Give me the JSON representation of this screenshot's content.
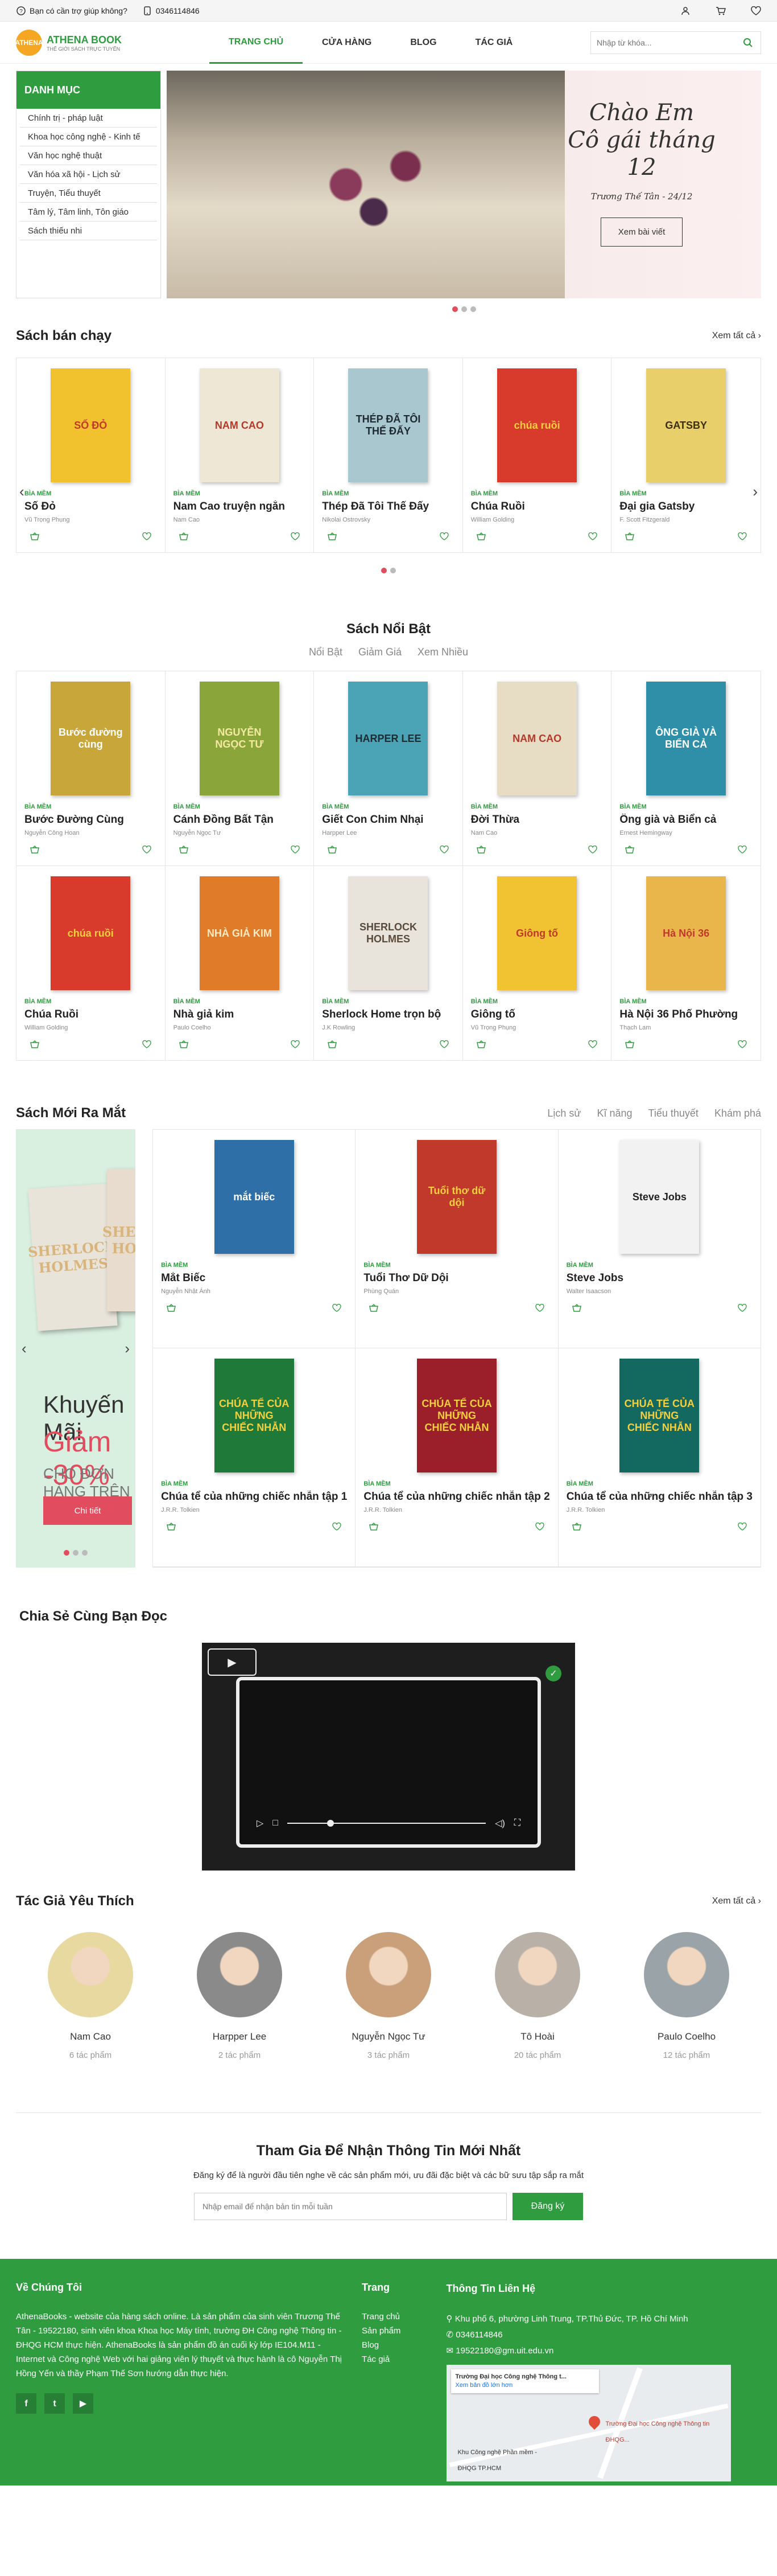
{
  "topbar": {
    "help": "Bạn có cần trợ giúp không?",
    "phone": "0346114846"
  },
  "header": {
    "logo_text": "ATHENA BOOK",
    "logo_mark": "ATHENA",
    "logo_sub": "THẾ GIỚI SÁCH TRỰC TUYẾN",
    "nav": [
      "TRANG CHỦ",
      "CỬA HÀNG",
      "BLOG",
      "TÁC GIẢ"
    ],
    "search_placeholder": "Nhập từ khóa..."
  },
  "categories": {
    "title": "DANH MỤC",
    "items": [
      "Chính trị - pháp luật",
      "Khoa học công nghệ - Kinh tế",
      "Văn học nghệ thuật",
      "Văn hóa xã hội - Lịch sử",
      "Truyện, Tiểu thuyết",
      "Tâm lý, Tâm linh, Tôn giáo",
      "Sách thiếu nhi"
    ]
  },
  "slide": {
    "line1": "Chào Em",
    "line2": "Cô gái tháng 12",
    "line3": "Trương Thế Tân - 24/12",
    "button": "Xem bài viết"
  },
  "bestseller": {
    "title": "Sách bán chạy",
    "see_all": "Xem tất cả",
    "books": [
      {
        "tag": "BÌA MỀM",
        "name": "Số Đỏ",
        "author": "Vũ Trọng Phụng",
        "cover_text": "SỐ ĐỎ",
        "bg": "#f2c12e",
        "fg": "#c0392b"
      },
      {
        "tag": "BÌA MỀM",
        "name": "Nam Cao truyện ngắn",
        "author": "Nam Cao",
        "cover_text": "NAM CAO",
        "bg": "#efe7d6",
        "fg": "#b23a2a"
      },
      {
        "tag": "BÌA MỀM",
        "name": "Thép Đã Tôi Thế Đấy",
        "author": "Nikolai Ostrovsky",
        "cover_text": "THÉP ĐÃ TÔI THẾ ĐẤY",
        "bg": "#a9c7cf",
        "fg": "#1f2a30"
      },
      {
        "tag": "BÌA MỀM",
        "name": "Chúa Ruồi",
        "author": "William Golding",
        "cover_text": "chúa ruồi",
        "bg": "#d83a2b",
        "fg": "#f4d03f"
      },
      {
        "tag": "BÌA MỀM",
        "name": "Đại gia Gatsby",
        "author": "F. Scott Fitzgerald",
        "cover_text": "GATSBY",
        "bg": "#e9cf6a",
        "fg": "#3b2f12"
      }
    ]
  },
  "featured": {
    "title": "Sách Nổi Bật",
    "tabs": [
      "Nổi Bật",
      "Giảm Giá",
      "Xem Nhiều"
    ],
    "books": [
      {
        "tag": "BÌA MỀM",
        "name": "Bước Đường Cùng",
        "author": "Nguyễn Công Hoan",
        "cover_text": "Bước đường cùng",
        "bg": "#c9a63a",
        "fg": "#fff"
      },
      {
        "tag": "BÌA MỀM",
        "name": "Cánh Đồng Bất Tận",
        "author": "Nguyễn Ngọc Tư",
        "cover_text": "NGUYỄN NGỌC TƯ",
        "bg": "#8aa53a",
        "fg": "#f4e9a1"
      },
      {
        "tag": "BÌA MỀM",
        "name": "Giết Con Chim Nhại",
        "author": "Harpper Lee",
        "cover_text": "HARPER LEE",
        "bg": "#4aa4b5",
        "fg": "#1d2b33"
      },
      {
        "tag": "BÌA MỀM",
        "name": "Đời Thừa",
        "author": "Nam Cao",
        "cover_text": "NAM CAO",
        "bg": "#e7dcc4",
        "fg": "#b23a2a"
      },
      {
        "tag": "BÌA MỀM",
        "name": "Ông già và Biển cả",
        "author": "Ernest Hemingway",
        "cover_text": "ÔNG GIÀ VÀ BIỂN CẢ",
        "bg": "#2f8fa8",
        "fg": "#fff"
      },
      {
        "tag": "BÌA MỀM",
        "name": "Chúa Ruồi",
        "author": "William Golding",
        "cover_text": "chúa ruồi",
        "bg": "#d83a2b",
        "fg": "#f4d03f"
      },
      {
        "tag": "BÌA MỀM",
        "name": "Nhà giả kim",
        "author": "Paulo Coelho",
        "cover_text": "NHÀ GIẢ KIM",
        "bg": "#e07b2a",
        "fg": "#fde9c0"
      },
      {
        "tag": "BÌA MỀM",
        "name": "Sherlock Home trọn bộ",
        "author": "J.K Rowling",
        "cover_text": "SHERLOCK HOLMES",
        "bg": "#e8e4dc",
        "fg": "#5a4a3a"
      },
      {
        "tag": "BÌA MỀM",
        "name": "Giông tố",
        "author": "Vũ Trọng Phụng",
        "cover_text": "Giông tố",
        "bg": "#f1c232",
        "fg": "#c0392b"
      },
      {
        "tag": "BÌA MỀM",
        "name": "Hà Nội 36 Phố Phường",
        "author": "Thạch Lam",
        "cover_text": "Hà Nội 36",
        "bg": "#e8b64a",
        "fg": "#c0392b"
      }
    ]
  },
  "new_release": {
    "title": "Sách Mới Ra Mắt",
    "tabs": [
      "Lịch sử",
      "Kĩ năng",
      "Tiểu thuyết",
      "Khám phá"
    ],
    "promo": {
      "t1": "Khuyến Mãi",
      "t2": "Giảm -30%",
      "t3": "CHO ĐƠN HÀNG TRÊN 900K",
      "button": "Chi tiết",
      "book_text": "SHERLOCK HOLMES"
    },
    "books": [
      {
        "tag": "BÌA MỀM",
        "name": "Mắt Biếc",
        "author": "Nguyễn Nhật Ánh",
        "cover_text": "mắt biếc",
        "bg": "#2f6fa8",
        "fg": "#fff"
      },
      {
        "tag": "BÌA MỀM",
        "name": "Tuổi Thơ Dữ Dội",
        "author": "Phùng Quán",
        "cover_text": "Tuổi thơ dữ dội",
        "bg": "#c0392b",
        "fg": "#f4d03f"
      },
      {
        "tag": "BÌA MỀM",
        "name": "Steve Jobs",
        "author": "Walter Isaacson",
        "cover_text": "Steve Jobs",
        "bg": "#f2f2f2",
        "fg": "#222"
      },
      {
        "tag": "BÌA MỀM",
        "name": "Chúa tể của những chiếc nhẫn tập 1",
        "author": "J.R.R. Tolkien",
        "cover_text": "CHÚA TỂ CỦA NHỮNG CHIẾC NHẪN",
        "bg": "#1f7a3a",
        "fg": "#f4d03f"
      },
      {
        "tag": "BÌA MỀM",
        "name": "Chúa tể của những chiếc nhẫn tập 2",
        "author": "J.R.R. Tolkien",
        "cover_text": "CHÚA TỂ CỦA NHỮNG CHIẾC NHẪN",
        "bg": "#9a1f2a",
        "fg": "#f4d03f"
      },
      {
        "tag": "BÌA MỀM",
        "name": "Chúa tể của những chiếc nhẫn tập 3",
        "author": "J.R.R. Tolkien",
        "cover_text": "CHÚA TỂ CỦA NHỮNG CHIẾC NHẪN",
        "bg": "#13695f",
        "fg": "#f4d03f"
      }
    ]
  },
  "share": {
    "title": "Chia Sẻ Cùng Bạn Đọc"
  },
  "authors": {
    "title": "Tác Giả Yêu Thích",
    "see_all": "Xem tất cả",
    "items": [
      {
        "name": "Nam Cao",
        "count": "6 tác phẩm",
        "bg": "#e8d9a0"
      },
      {
        "name": "Harpper Lee",
        "count": "2 tác phẩm",
        "bg": "#8a8a8a"
      },
      {
        "name": "Nguyễn Ngọc Tư",
        "count": "3 tác phẩm",
        "bg": "#c9a07a"
      },
      {
        "name": "Tô Hoài",
        "count": "20 tác phẩm",
        "bg": "#b9b1a8"
      },
      {
        "name": "Paulo Coelho",
        "count": "12 tác phẩm",
        "bg": "#9aa3a8"
      }
    ]
  },
  "newsletter": {
    "title": "Tham Gia Để Nhận Thông Tin Mới Nhất",
    "desc": "Đăng ký để là người đầu tiên nghe về các sản phẩm mới, ưu đãi đặc biệt và các bữ sưu tập sắp ra mắt",
    "placeholder": "Nhập email để nhận bản tin mỗi tuần",
    "button": "Đăng ký"
  },
  "footer": {
    "about_title": "Về Chúng Tôi",
    "about_text": "AthenaBooks - website của hàng sách online. Là sản phẩm của sinh viên Trương Thế Tân - 19522180, sinh viên khoa Khoa học Máy tính, trường ĐH Công nghệ Thông tin - ĐHQG HCM thực hiện. AthenaBooks là sản phẩm đồ án cuối kỳ lớp IE104.M11 - Internet và Công nghệ Web với hai giảng viên lý thuyết và thực hành là cô Nguyễn Thị Hồng Yến và thầy Phạm Thế Sơn hướng dẫn thực hiện.",
    "links_title": "Trang",
    "links": [
      "Trang chủ",
      "Sản phẩm",
      "Blog",
      "Tác giả"
    ],
    "contact_title": "Thông Tin Liên Hệ",
    "address": "Khu phố 6, phường Linh Trung, TP.Thủ Đức, TP. Hồ Chí Minh",
    "phone": "0346114846",
    "email": "19522180@gm.uit.edu.vn",
    "socials": [
      "f",
      "t",
      "▶"
    ],
    "map_card": "Trường Đại học Công nghệ Thông t...",
    "map_link": "Xem bản đồ lớn hơn",
    "map_place": "Khu Công nghệ Phần mềm - ĐHQG TP.HCM",
    "map_label": "Trường Đại học Công nghệ Thông tin ĐHQG..."
  }
}
